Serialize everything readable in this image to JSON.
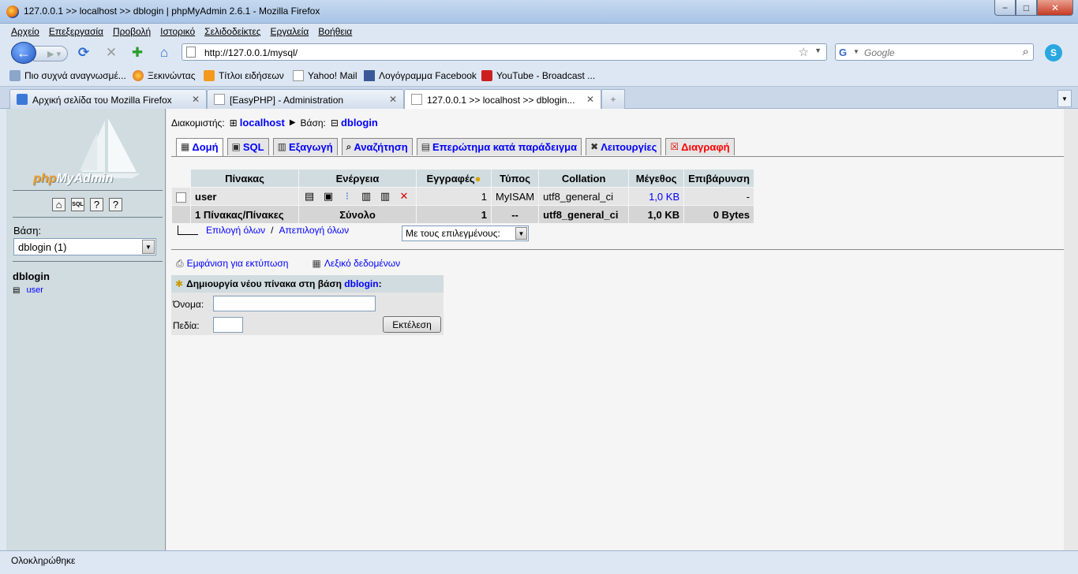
{
  "window": {
    "title": "127.0.0.1 >> localhost >> dblogin | phpMyAdmin 2.6.1 - Mozilla Firefox",
    "min": "−",
    "max": "□",
    "close": "✕"
  },
  "menu": [
    "Αρχείο",
    "Επεξεργασία",
    "Προβολή",
    "Ιστορικό",
    "Σελιδοδείκτες",
    "Εργαλεία",
    "Βοήθεια"
  ],
  "nav": {
    "url": "http://127.0.0.1/mysql/",
    "search_placeholder": "Google"
  },
  "bookmarks": [
    {
      "label": "Πιο συχνά αναγνωσμέ...",
      "icon": "gear-icon"
    },
    {
      "label": "Ξεκινώντας",
      "icon": "firefox-icon"
    },
    {
      "label": "Τίτλοι ειδήσεων",
      "icon": "rss-icon"
    },
    {
      "label": "Yahoo! Mail",
      "icon": "page-icon"
    },
    {
      "label": "Λογόγραμμα Facebook",
      "icon": "facebook-icon"
    },
    {
      "label": "YouTube - Broadcast ...",
      "icon": "youtube-icon"
    }
  ],
  "tabs": [
    {
      "label": "Αρχική σελίδα του Mozilla Firefox",
      "active": false
    },
    {
      "label": "[EasyPHP] - Administration",
      "active": false
    },
    {
      "label": "127.0.0.1 >> localhost >> dblogin...",
      "active": true
    }
  ],
  "left": {
    "logo_php": "php",
    "logo_myadmin": "MyAdmin",
    "db_label": "Βάση:",
    "db_selected": "dblogin (1)",
    "db_name": "dblogin",
    "tables": [
      "user"
    ]
  },
  "crumb": {
    "server_label": "Διακομιστής:",
    "server": "localhost",
    "db_label": "Βάση:",
    "db": "dblogin"
  },
  "page_tabs": [
    {
      "label": "Δομή",
      "active": true
    },
    {
      "label": "SQL"
    },
    {
      "label": "Εξαγωγή"
    },
    {
      "label": "Αναζήτηση"
    },
    {
      "label": "Επερώτημα κατά παράδειγμα"
    },
    {
      "label": "Λειτουργίες"
    },
    {
      "label": "Διαγραφή"
    }
  ],
  "table": {
    "headers": [
      "Πίνακας",
      "Ενέργεια",
      "Εγγραφές",
      "Τύπος",
      "Collation",
      "Μέγεθος",
      "Επιβάρυνση"
    ],
    "rows": [
      {
        "name": "user",
        "records": "1",
        "type": "MyISAM",
        "collation": "utf8_general_ci",
        "size": "1,0 KB",
        "overhead": "-"
      }
    ],
    "summary": {
      "name": "1 Πίνακας/Πίνακες",
      "label": "Σύνολο",
      "records": "1",
      "type": "--",
      "collation": "utf8_general_ci",
      "size": "1,0 KB",
      "overhead": "0 Bytes"
    }
  },
  "select": {
    "all": "Επιλογή όλων",
    "sep": "/",
    "none": "Απεπιλογή όλων",
    "with_selected": "Με τους επιλεγμένους:"
  },
  "links": {
    "print": "Εμφάνιση για εκτύπωση",
    "dict": "Λεξικό δεδομένων"
  },
  "create": {
    "title": "Δημιουργία νέου πίνακα στη βάση",
    "db": "dblogin",
    "colon": ":",
    "name_label": "Όνομα:",
    "fields_label": "Πεδία:",
    "go": "Εκτέλεση"
  },
  "status": "Ολοκληρώθηκε"
}
